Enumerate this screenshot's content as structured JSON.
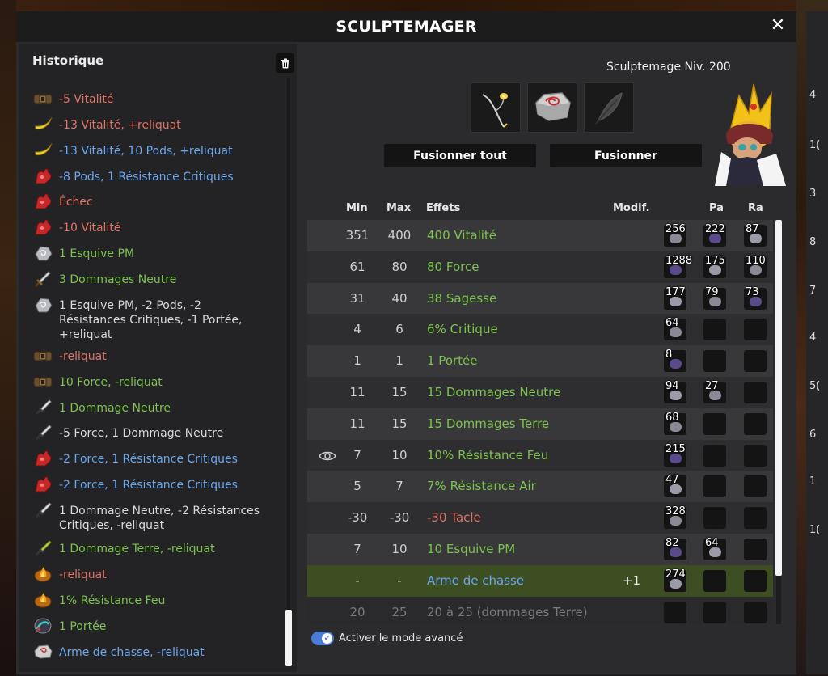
{
  "window": {
    "title": "SCULPTEMAGER",
    "close_glyph": "✕"
  },
  "history": {
    "title": "Historique",
    "items": [
      {
        "text": "-5 Vitalité",
        "color": "red",
        "icon": "belt-icon"
      },
      {
        "text": "-13 Vitalité, +reliquat",
        "color": "red",
        "icon": "banana-icon"
      },
      {
        "text": "-13 Vitalité, 10 Pods, +reliquat",
        "color": "blue",
        "icon": "banana-icon"
      },
      {
        "text": "-8 Pods, 1 Résistance Critiques",
        "color": "blue",
        "icon": "red-glove-icon"
      },
      {
        "text": "Échec",
        "color": "red",
        "icon": "red-glove-icon"
      },
      {
        "text": "-10 Vitalité",
        "color": "red",
        "icon": "red-glove-icon"
      },
      {
        "text": "1 Esquive PM",
        "color": "green",
        "icon": "silver-rune-icon"
      },
      {
        "text": "3 Dommages Neutre",
        "color": "green",
        "icon": "sword-icon"
      },
      {
        "text": "1 Esquive PM, -2 Pods, -2 Résistances Critiques, -1 Portée, +reliquat",
        "color": "white",
        "icon": "silver-rune-icon"
      },
      {
        "text": "-reliquat",
        "color": "red",
        "icon": "belt-icon"
      },
      {
        "text": "10 Force, -reliquat",
        "color": "green",
        "icon": "belt-icon"
      },
      {
        "text": "1 Dommage Neutre",
        "color": "green",
        "icon": "dagger-icon"
      },
      {
        "text": "-5 Force, 1 Dommage Neutre",
        "color": "white",
        "icon": "dagger-icon"
      },
      {
        "text": "-2 Force, 1 Résistance Critiques",
        "color": "blue",
        "icon": "red-glove-icon"
      },
      {
        "text": "-2 Force, 1 Résistance Critiques",
        "color": "blue",
        "icon": "red-glove-icon"
      },
      {
        "text": "1 Dommage Neutre, -2 Résistances Critiques, -reliquat",
        "color": "white",
        "icon": "dagger-icon"
      },
      {
        "text": "1 Dommage Terre, -reliquat",
        "color": "green",
        "icon": "green-dagger-icon"
      },
      {
        "text": "-reliquat",
        "color": "red",
        "icon": "fire-rune-icon"
      },
      {
        "text": "1% Résistance Feu",
        "color": "green",
        "icon": "fire-rune-icon"
      },
      {
        "text": "1 Portée",
        "color": "green",
        "icon": "range-rune-icon"
      },
      {
        "text": "Arme de chasse, -reliquat",
        "color": "blue",
        "icon": "hunting-stone-icon"
      }
    ]
  },
  "rank": "Sculptemage Niv. 200",
  "slots": [
    {
      "name": "item-slot",
      "icon": "whip-weapon-icon"
    },
    {
      "name": "rune-slot",
      "icon": "hunting-stone-icon"
    },
    {
      "name": "empty-slot",
      "icon": "feather-icon"
    }
  ],
  "buttons": {
    "fuse_all": "Fusionner tout",
    "fuse": "Fusionner"
  },
  "table": {
    "headers": {
      "min": "Min",
      "max": "Max",
      "effects": "Effets",
      "modif": "Modif.",
      "pa": "Pa",
      "ra": "Ra"
    },
    "rows": [
      {
        "min": "351",
        "max": "400",
        "effect": "400 Vitalité",
        "color": "green",
        "modif": "",
        "runes": [
          "256",
          "222",
          "87"
        ]
      },
      {
        "min": "61",
        "max": "80",
        "effect": "80 Force",
        "color": "green",
        "modif": "",
        "runes": [
          "1288",
          "175",
          "110"
        ]
      },
      {
        "min": "31",
        "max": "40",
        "effect": "38 Sagesse",
        "color": "green",
        "modif": "",
        "runes": [
          "177",
          "79",
          "73"
        ]
      },
      {
        "min": "4",
        "max": "6",
        "effect": "6% Critique",
        "color": "green",
        "modif": "",
        "runes": [
          "64",
          "",
          ""
        ]
      },
      {
        "min": "1",
        "max": "1",
        "effect": "1 Portée",
        "color": "green",
        "modif": "",
        "runes": [
          "8",
          "",
          ""
        ]
      },
      {
        "min": "11",
        "max": "15",
        "effect": "15 Dommages Neutre",
        "color": "green",
        "modif": "",
        "runes": [
          "94",
          "27",
          ""
        ]
      },
      {
        "min": "11",
        "max": "15",
        "effect": "15 Dommages Terre",
        "color": "green",
        "modif": "",
        "runes": [
          "68",
          "",
          ""
        ]
      },
      {
        "min": "7",
        "max": "10",
        "effect": "10% Résistance Feu",
        "color": "green",
        "modif": "",
        "runes": [
          "215",
          "",
          ""
        ],
        "eye": true
      },
      {
        "min": "5",
        "max": "7",
        "effect": "7% Résistance Air",
        "color": "green",
        "modif": "",
        "runes": [
          "47",
          "",
          ""
        ]
      },
      {
        "min": "-30",
        "max": "-30",
        "effect": "-30 Tacle",
        "color": "red",
        "modif": "",
        "runes": [
          "328",
          "",
          ""
        ]
      },
      {
        "min": "7",
        "max": "10",
        "effect": "10 Esquive PM",
        "color": "green",
        "modif": "",
        "runes": [
          "82",
          "64",
          ""
        ]
      },
      {
        "min": "-",
        "max": "-",
        "effect": "Arme de chasse",
        "color": "blue",
        "modif": "+1",
        "runes": [
          "274",
          "",
          ""
        ]
      },
      {
        "min": "20",
        "max": "25",
        "effect": "20 à 25 (dommages Terre)",
        "color": "gray",
        "modif": "",
        "runes": [
          "",
          "",
          ""
        ]
      }
    ]
  },
  "advanced_mode": {
    "label": "Activer le mode avancé",
    "enabled": true
  },
  "side_numbers": [
    "4",
    "1(",
    "3",
    "8",
    "7",
    "4",
    "5(",
    "6",
    "1",
    "1("
  ],
  "colors": {
    "red": "#e07464",
    "green": "#7cc24e",
    "blue": "#6aa6ee",
    "white": "#d8d8d8",
    "accent": "#4a7bd6"
  }
}
